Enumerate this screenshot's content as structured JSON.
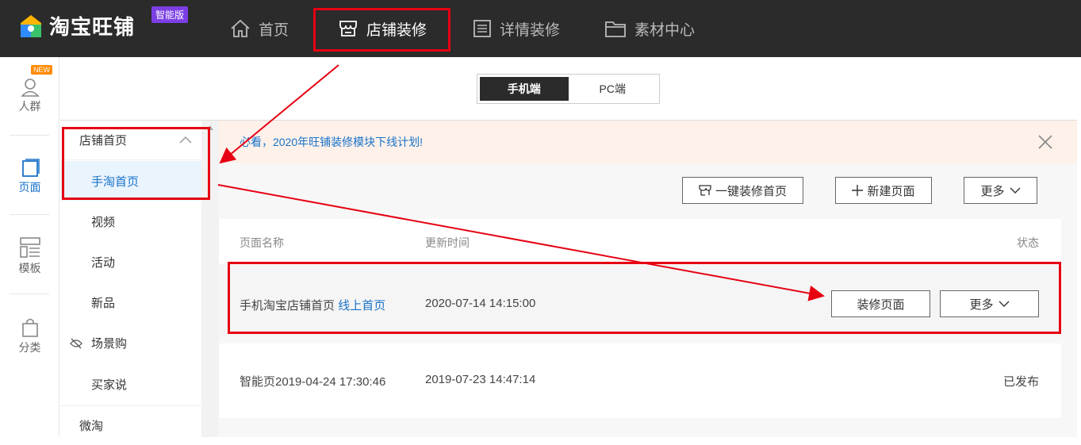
{
  "header": {
    "app_name": "淘宝旺铺",
    "edition_badge": "智能版",
    "nav": [
      {
        "label": "首页",
        "icon": "home-icon"
      },
      {
        "label": "店铺装修",
        "icon": "store-icon"
      },
      {
        "label": "详情装修",
        "icon": "list-icon"
      },
      {
        "label": "素材中心",
        "icon": "folder-icon"
      }
    ],
    "active_nav": "店铺装修"
  },
  "leftbar": {
    "new_badge": "NEW",
    "items": [
      {
        "label": "人群",
        "icon": "user-icon"
      },
      {
        "label": "页面",
        "icon": "page-icon"
      },
      {
        "label": "模板",
        "icon": "template-icon"
      },
      {
        "label": "分类",
        "icon": "bag-icon"
      }
    ],
    "active": "页面"
  },
  "device_switch": {
    "options": [
      "手机端",
      "PC端"
    ],
    "selected": "手机端"
  },
  "subnav": {
    "group1": "店铺首页",
    "items": [
      "手淘首页",
      "视频",
      "活动",
      "新品",
      "场景购",
      "买家说"
    ],
    "active": "手淘首页",
    "group2": "微淘"
  },
  "notice": {
    "text": "必看，2020年旺铺装修模块下线计划!"
  },
  "toolbar": {
    "one_click": "一键装修首页",
    "new_page": "新建页面",
    "more": "更多"
  },
  "table": {
    "columns": [
      "页面名称",
      "更新时间",
      "状态"
    ],
    "rows": [
      {
        "name": "手机淘宝店铺首页",
        "tag": "线上首页",
        "updated": "2020-07-14 14:15:00",
        "action": "装修页面",
        "more": "更多"
      },
      {
        "name": "智能页2019-04-24 17:30:46",
        "updated": "2019-07-23 14:47:14",
        "status": "已发布"
      }
    ]
  },
  "colors": {
    "highlight": "#e60012",
    "link": "#1a73c9",
    "topbar": "#2b2b2b",
    "badge": "#7b3fe4"
  }
}
